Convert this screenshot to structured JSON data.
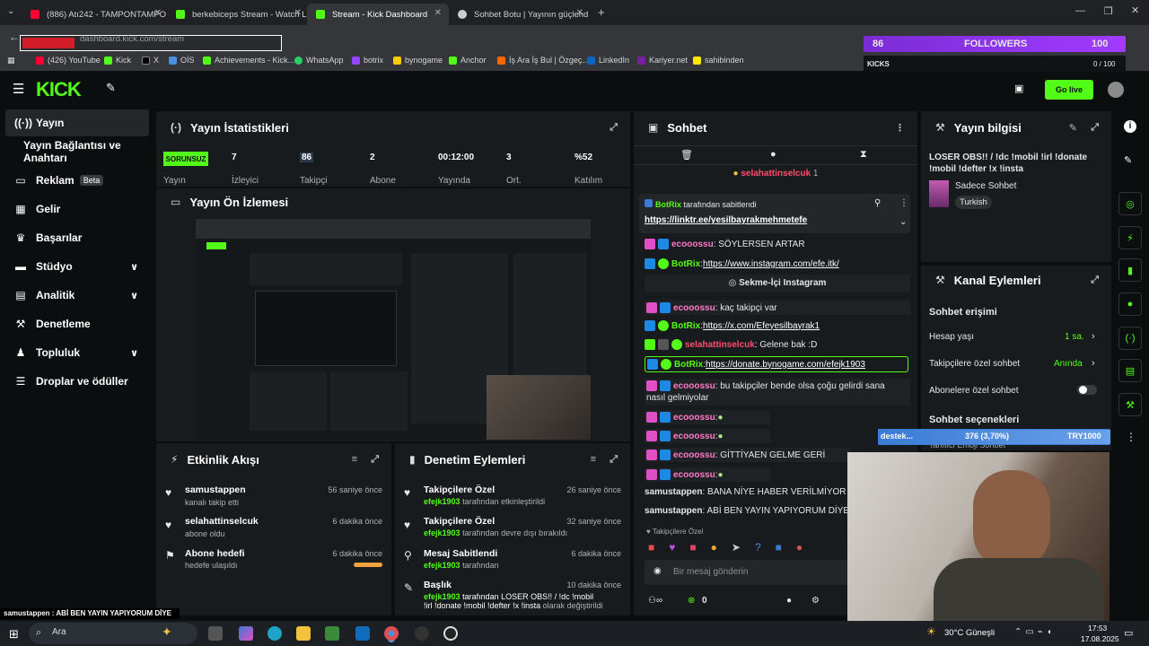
{
  "browser": {
    "tabs": [
      {
        "label": "(886) Atı242 - TAMPONTAMPO",
        "fav": "#ff0033"
      },
      {
        "label": "berkebiceps Stream - Watch Li",
        "fav": "#53fc18"
      },
      {
        "label": "Stream - Kick Dashboard",
        "fav": "#53fc18"
      },
      {
        "label": "Sohbet Botu | Yayının güçlend",
        "fav": "#cccccc"
      }
    ],
    "url": "dashboard.kick.com/stream",
    "bookmarks": [
      "(426) YouTube",
      "Kick",
      "X",
      "OİS",
      "Achievements - Kick...",
      "WhatsApp",
      "botrix",
      "bynogame",
      "Anchor",
      "İş Ara İş Bul | Özgeç...",
      "LinkedIn",
      "Kariyer.net",
      "sahibinden"
    ]
  },
  "overlay": {
    "followers_count": "86",
    "followers_label": "FOLLOWERS",
    "followers_goal": "100",
    "kicks_label": "KICKS",
    "kicks_value": "0 / 100",
    "donation_name": "destek...",
    "donation_pct": "376 (3,70%)",
    "donation_target": "TRY1000",
    "bottom_caption": "samustappen : ABİ BEN YAYIN YAPIYORUM DİYE"
  },
  "header": {
    "logo": "KICK",
    "golive": "Go live"
  },
  "sidebar": {
    "items": [
      {
        "label": "Yayın",
        "icon": "broadcast-icon"
      },
      {
        "label": "Yayın Bağlantısı ve Anahtarı",
        "icon": ""
      },
      {
        "label": "Reklam",
        "icon": "ad-icon",
        "badge": "Beta"
      },
      {
        "label": "Gelir",
        "icon": "revenue-icon"
      },
      {
        "label": "Başarılar",
        "icon": "trophy-icon"
      },
      {
        "label": "Stüdyo",
        "icon": "studio-icon",
        "chev": "⌄"
      },
      {
        "label": "Analitik",
        "icon": "analytics-icon",
        "chev": "⌄"
      },
      {
        "label": "Denetleme",
        "icon": "moderation-icon"
      },
      {
        "label": "Topluluk",
        "icon": "community-icon",
        "chev": "⌄"
      },
      {
        "label": "Droplar ve ödüller",
        "icon": "drops-icon"
      }
    ]
  },
  "stats": {
    "title": "Yayın İstatistikleri",
    "status_badge": "SORUNSUZ",
    "status_label": "Yayın",
    "items": [
      {
        "value": "7",
        "label": "İzleyici"
      },
      {
        "value": "86",
        "label": "Takipçi"
      },
      {
        "value": "2",
        "label": "Abone"
      },
      {
        "value": "00:12:00",
        "label": "Yayında"
      },
      {
        "value": "3",
        "label": "Ort."
      },
      {
        "value": "%52",
        "label": "Katılım"
      }
    ]
  },
  "preview": {
    "title": "Yayın Ön İzlemesi"
  },
  "activity": {
    "title": "Etkinlik Akışı",
    "items": [
      {
        "name": "samustappen",
        "sub": "kanalı takip etti",
        "time": "56 saniye önce"
      },
      {
        "name": "selahattinselcuk",
        "sub": "abone oldu",
        "time": "6 dakika önce"
      },
      {
        "name": "Abone hedefi",
        "sub": "hedefe ulaşıldı",
        "time": "6 dakika önce"
      }
    ]
  },
  "moderation": {
    "title": "Denetim Eylemleri",
    "items": [
      {
        "title": "Takipçilere Özel",
        "user": "efejk1903",
        "text": "tarafından etkinleştirildi",
        "time": "26 saniye önce"
      },
      {
        "title": "Takipçilere Özel",
        "user": "efejk1903",
        "text": "tarafından devre dışı bırakıldı",
        "time": "32 saniye önce"
      },
      {
        "title": "Mesaj Sabitlendi",
        "user": "efejk1903",
        "text": "tarafından",
        "time": "6 dakika önce"
      },
      {
        "title": "Başlık",
        "user": "efejk1903",
        "text": "tarafından LOSER OBS!! / !dc !mobil !irl !donate",
        "text2": "!mobil !defter !x !insta",
        "text3": "olarak değiştirildi",
        "time": "10 dakika önce"
      }
    ]
  },
  "chat": {
    "title": "Sohbet",
    "gift_user": "selahattinselcuk",
    "gift_count": "1",
    "pinned_by": "BotRix",
    "pinned_note": "tarafından sabitlendi",
    "pinned_link": "https://linktr.ee/yesilbayrakmehmetefe",
    "messages": [
      {
        "user": "ecooossu",
        "color": "#ff7ac8",
        "text": ": SÖYLERSEN ARTAR"
      },
      {
        "user": "BotRix",
        "color": "#53fc18",
        "text": ": ",
        "link": "https://www.instagram.com/efe.itk/"
      },
      {
        "system": "Sekme-İçi Instagram"
      },
      {
        "user": "ecooossu",
        "color": "#ff7ac8",
        "text": ": kaç takipçi var"
      },
      {
        "user": "BotRix",
        "color": "#53fc18",
        "text": ": ",
        "link": "https://x.com/Efeyesilbayrak1"
      },
      {
        "user": "selahattinselcuk",
        "color": "#ff4d6d",
        "text": ": Gelene bak :D"
      },
      {
        "user": "BotRix",
        "color": "#53fc18",
        "text": ": ",
        "link": "https://donate.bynogame.com/efejk1903"
      },
      {
        "user": "ecooossu",
        "color": "#ff7ac8",
        "text": ": bu takipçiler bende olsa çoğu gelirdi sana",
        "text2": "nasıl gelmiyolar"
      },
      {
        "user": "ecooossu",
        "color": "#ff7ac8",
        "text": ": "
      },
      {
        "user": "ecooossu",
        "color": "#ff7ac8",
        "text": ": "
      },
      {
        "user": "ecooossu",
        "color": "#ff7ac8",
        "text": ": GİTTİYAEN GELME GERİ"
      },
      {
        "user": "ecooossu",
        "color": "#ff7ac8",
        "text": ": "
      },
      {
        "user": "samustappen",
        "color": "#e6e6e6",
        "text": ": BANA NİYE HABER VERİLMİYOR"
      },
      {
        "user": "samustappen",
        "color": "#e6e6e6",
        "text": ": ABİ BEN YAYIN YAPIYORUM DİYE"
      }
    ],
    "followers_only": "Takipçilere Özel",
    "input_placeholder": "Bir mesaj gönderin",
    "points": "0"
  },
  "streaminfo": {
    "title": "Yayın bilgisi",
    "stream_title": "LOSER OBS!! / !dc !mobil !irl !donate !mobil !defter !x !insta",
    "category": "Sadece Sohbet",
    "tag": "Turkish"
  },
  "channel": {
    "title": "Kanal Eylemleri",
    "chat_access": "Sohbet erişimi",
    "rows": [
      {
        "label": "Hesap yaşı",
        "value": "1 sa."
      },
      {
        "label": "Takipçilere özel sohbet",
        "value": "Anında"
      },
      {
        "label": "Abonelere özel sohbet",
        "value": ""
      }
    ],
    "options": "Sohbet seçenekleri",
    "options_sub": "Tanıtıcı Emoji Sohbet"
  },
  "taskbar": {
    "search": "Ara",
    "weather": "30°C Güneşli",
    "time": "17:53",
    "date": "17.08.2025"
  },
  "colors": {
    "kick_green": "#53fc18",
    "panel": "#181b1d",
    "bg": "#0b0e0f"
  }
}
